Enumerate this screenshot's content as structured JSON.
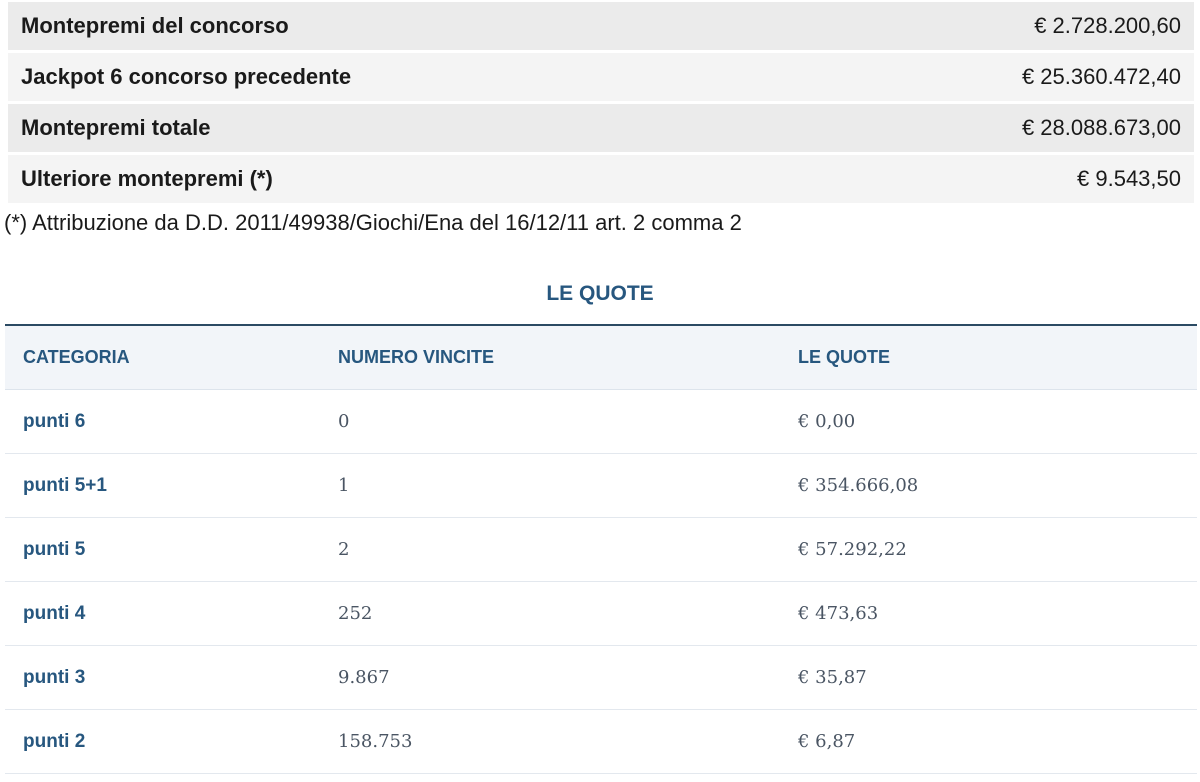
{
  "summary": {
    "rows": [
      {
        "label": "Montepremi del concorso",
        "value": "€ 2.728.200,60"
      },
      {
        "label": "Jackpot 6 concorso precedente",
        "value": "€ 25.360.472,40"
      },
      {
        "label": "Montepremi totale",
        "value": "€ 28.088.673,00"
      },
      {
        "label": "Ulteriore montepremi (*)",
        "value": "€ 9.543,50"
      }
    ],
    "footnote": "(*) Attribuzione da D.D. 2011/49938/Giochi/Ena del 16/12/11 art. 2 comma 2"
  },
  "quote": {
    "title": "LE QUOTE",
    "headers": [
      "CATEGORIA",
      "NUMERO VINCITE",
      "LE QUOTE"
    ],
    "rows": [
      {
        "categoria": "punti 6",
        "vincite": "0",
        "quota": "€ 0,00"
      },
      {
        "categoria": "punti 5+1",
        "vincite": "1",
        "quota": "€ 354.666,08"
      },
      {
        "categoria": "punti 5",
        "vincite": "2",
        "quota": "€ 57.292,22"
      },
      {
        "categoria": "punti 4",
        "vincite": "252",
        "quota": "€ 473,63"
      },
      {
        "categoria": "punti 3",
        "vincite": "9.867",
        "quota": "€ 35,87"
      },
      {
        "categoria": "punti 2",
        "vincite": "158.753",
        "quota": "€ 6,87"
      }
    ]
  }
}
